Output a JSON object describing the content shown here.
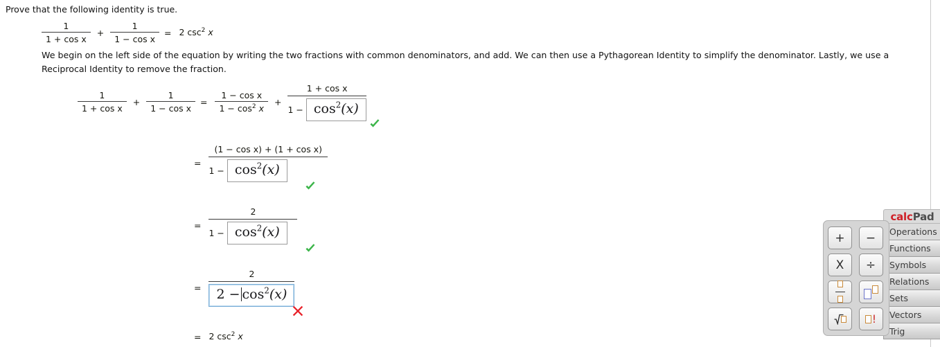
{
  "prompt": "Prove that the following identity is true.",
  "identity": {
    "left_frac1_num": "1",
    "left_frac1_den": "1 + cos x",
    "plus": "+",
    "left_frac2_num": "1",
    "left_frac2_den": "1 − cos x",
    "equals": "=",
    "rhs_coefficient": "2",
    "rhs_func": "csc",
    "rhs_exponent": "2",
    "rhs_var": "x"
  },
  "explanation": "We begin on the left side of the equation by writing the two fractions with common denominators, and add. We can then use a Pythagorean Identity to simplify the denominator. Lastly, we use a Reciprocal Identity to remove the fraction.",
  "work": {
    "line1": {
      "f1_num": "1",
      "f1_den": "1 + cos x",
      "plus1": "+",
      "f2_num": "1",
      "f2_den": "1 − cos x",
      "equals": "=",
      "f3_num": "1 − cos x",
      "f3_den_pre": "1 − cos",
      "f3_den_exp": "2",
      "f3_den_post": "x",
      "plus2": "+",
      "big_num": "1 + cos x",
      "big_den_lead": "1 −",
      "answer_value": "cos²(x)",
      "answer_base": "cos",
      "answer_exp": "2",
      "answer_arg": "(x)",
      "status": "correct"
    },
    "line2": {
      "equals": "=",
      "big_num": "(1 − cos x) + (1 + cos x)",
      "big_den_lead": "1 −",
      "answer_base": "cos",
      "answer_exp": "2",
      "answer_arg": "(x)",
      "status": "correct"
    },
    "line3": {
      "equals": "=",
      "big_num": "2",
      "big_den_lead": "1 −",
      "answer_base": "cos",
      "answer_exp": "2",
      "answer_arg": "(x)",
      "status": "correct"
    },
    "line4": {
      "equals": "=",
      "big_num": "2",
      "answer_lead": "2 −",
      "answer_base": "cos",
      "answer_exp": "2",
      "answer_arg": "(x)",
      "status": "incorrect",
      "focused": true
    },
    "line5": {
      "equals": "=",
      "coefficient": "2",
      "func": "csc",
      "exponent": "2",
      "var": "x"
    }
  },
  "marks": {
    "correct_color": "#3cb54a",
    "incorrect_color": "#e8222a",
    "correct_name": "green-check",
    "incorrect_name": "red-x"
  },
  "calcpad": {
    "title_calc": "calc",
    "title_pad": "Pad",
    "tabs": [
      {
        "label": "Operations",
        "active": true
      },
      {
        "label": "Functions",
        "active": false
      },
      {
        "label": "Symbols",
        "active": false
      },
      {
        "label": "Relations",
        "active": false
      },
      {
        "label": "Sets",
        "active": false
      },
      {
        "label": "Vectors",
        "active": false
      },
      {
        "label": "Trig",
        "active": false
      }
    ],
    "keys": [
      {
        "name": "plus-key",
        "glyph": "+"
      },
      {
        "name": "minus-key",
        "glyph": "−"
      },
      {
        "name": "multiply-key",
        "glyph": "X"
      },
      {
        "name": "divide-key",
        "glyph": "÷"
      },
      {
        "name": "fraction-key",
        "glyph": "fraction"
      },
      {
        "name": "exponent-key",
        "glyph": "exponent"
      },
      {
        "name": "square-root-key",
        "glyph": "sqrt"
      },
      {
        "name": "factorial-key",
        "glyph": "factorial"
      }
    ],
    "accent_red": "#cf1f26",
    "placeholder_orange": "#c98a3a"
  }
}
